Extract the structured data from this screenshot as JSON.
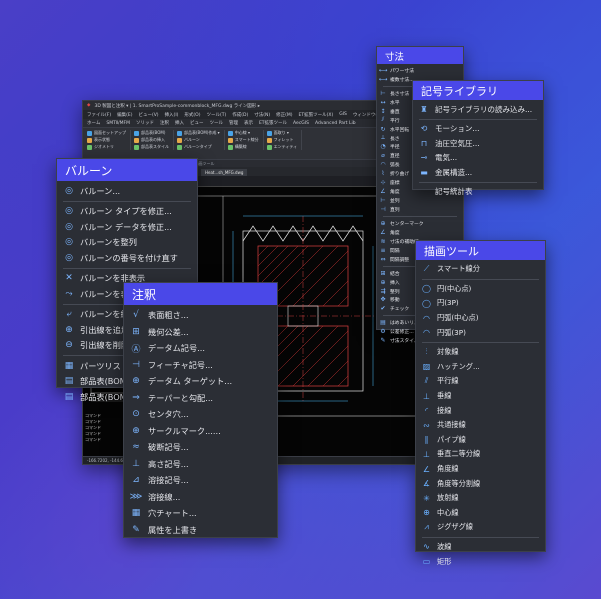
{
  "cad": {
    "title_bar": "3D 製図と注釈 ▾  |  1. SmartProSample-commonblock_MFG.dwg ライン図形 ▸",
    "menu": [
      "ファイル(F)",
      "編集(E)",
      "ビュー(V)",
      "挿入(I)",
      "形式(O)",
      "ツール(T)",
      "作成(D)",
      "寸法(N)",
      "修正(M)",
      "ET拡張ツール(X)",
      "GIS",
      "ウィンドウ(W)",
      "ヘルプ(H)",
      "ArcGIS"
    ],
    "ribbon_tabs": [
      "ホーム",
      "SMTⅡ/MFM",
      "ソリッド",
      "注釈",
      "挿入",
      "ビュー",
      "ツール",
      "管理",
      "表示",
      "ET拡張ツール",
      "AecGIS",
      "Advanced Part Lib"
    ],
    "ribbon_groups": [
      [
        "図面セットアップ",
        "表示状態",
        "ジオメトリ"
      ],
      [
        "部品表(BOM)",
        "部品表の挿入",
        "部品表スタイル"
      ],
      [
        "部品表(BOM)作成 ▾",
        "バルーン",
        "バルーンタイプ"
      ],
      [
        "中心線 ▾",
        "スマート線分",
        "構築線"
      ],
      [
        "面取り ▾",
        "フィレット",
        "エンティティ"
      ]
    ],
    "group_labels": [
      "バルーン 部品表(BOM)",
      "描画ツール"
    ],
    "doc_tab": "Heat...sh_MFG.dwg",
    "command_lines": [
      "コマンド",
      "コマンド",
      "コマンド",
      "コマンド",
      "コマンド"
    ],
    "status": "-166.7202, -144.6964, 0.0000"
  },
  "balloon": {
    "title": "バルーン",
    "items": [
      {
        "icon": "balloon-icon",
        "glyph": "◎",
        "label": "バルーン..."
      },
      {
        "sep": true
      },
      {
        "icon": "balloon-edit-icon",
        "glyph": "◎",
        "label": "バルーン タイプを修正..."
      },
      {
        "icon": "balloon-data-icon",
        "glyph": "◎",
        "label": "バルーン データを修正..."
      },
      {
        "icon": "balloon-align-icon",
        "glyph": "◎",
        "label": "バルーンを整列"
      },
      {
        "icon": "balloon-renumber-icon",
        "glyph": "◎",
        "label": "バルーンの番号を付け直す"
      },
      {
        "sep": true
      },
      {
        "icon": "balloon-hide-icon",
        "glyph": "✕",
        "label": "バルーンを非表示"
      },
      {
        "icon": "balloon-show-icon",
        "glyph": "⤳",
        "label": "バルーンを表示"
      },
      {
        "sep": true
      },
      {
        "icon": "balloon-merge-icon",
        "glyph": "⤶",
        "label": "バルーンを結合"
      },
      {
        "icon": "leader-add-icon",
        "glyph": "⊕",
        "label": "引出線を追加"
      },
      {
        "icon": "leader-delete-icon",
        "glyph": "⊖",
        "label": "引出線を削除"
      },
      {
        "sep": true
      },
      {
        "icon": "parts-list-icon",
        "glyph": "▦",
        "label": "パーツリストの生成"
      },
      {
        "icon": "bom-icon",
        "glyph": "▤",
        "label": "部品表(BOM)"
      },
      {
        "icon": "bom-icon-2",
        "glyph": "▤",
        "label": "部品表(BOM)"
      }
    ]
  },
  "annotation": {
    "title": "注釈",
    "items": [
      {
        "icon": "surface-roughness-icon",
        "glyph": "√",
        "label": "表面粗さ..."
      },
      {
        "icon": "geometric-tolerance-icon",
        "glyph": "⊞",
        "label": "幾何公差..."
      },
      {
        "icon": "datum-symbol-icon",
        "glyph": "Ⓐ",
        "label": "データム記号..."
      },
      {
        "icon": "feature-symbol-icon",
        "glyph": "⊣",
        "label": "フィーチャ記号..."
      },
      {
        "icon": "datum-target-icon",
        "glyph": "⊕",
        "label": "データム ターゲット..."
      },
      {
        "icon": "taper-slope-icon",
        "glyph": "⇒",
        "label": "テーパーと勾配..."
      },
      {
        "icon": "center-hole-icon",
        "glyph": "⊙",
        "label": "センタ穴..."
      },
      {
        "icon": "circle-mark-icon",
        "glyph": "⊕",
        "label": "サークルマーク......"
      },
      {
        "icon": "break-symbol-icon",
        "glyph": "≈",
        "label": "破断記号..."
      },
      {
        "icon": "height-symbol-icon",
        "glyph": "⊥",
        "label": "高さ記号..."
      },
      {
        "icon": "weld-symbol-icon",
        "glyph": "⊿",
        "label": "溶接記号..."
      },
      {
        "icon": "weld-line-icon",
        "glyph": "⋙",
        "label": "溶接線..."
      },
      {
        "icon": "hole-chart-icon",
        "glyph": "▦",
        "label": "穴チャート..."
      },
      {
        "icon": "attribute-override-icon",
        "glyph": "✎",
        "label": "属性を上書き"
      }
    ]
  },
  "dimension": {
    "title": "寸法",
    "items": [
      {
        "icon": "smart-dim-icon",
        "glyph": "⟷",
        "label": "パワー寸法"
      },
      {
        "icon": "multi-dim-icon",
        "glyph": "⟷",
        "label": "複数寸法..."
      },
      {
        "sep": true
      },
      {
        "icon": "ordinate-dim-icon",
        "glyph": "⊢",
        "label": "長さ寸法"
      },
      {
        "icon": "horizontal-dim-icon",
        "glyph": "↔",
        "label": "水平"
      },
      {
        "icon": "vertical-dim-icon",
        "glyph": "↕",
        "label": "垂直"
      },
      {
        "icon": "parallel-dim-icon",
        "glyph": "⫽",
        "label": "平行"
      },
      {
        "icon": "rotated-dim-icon",
        "glyph": "↻",
        "label": "水平回転"
      },
      {
        "icon": "sep-dim-icon",
        "glyph": "⟂",
        "label": "長さ"
      },
      {
        "icon": "radius-dim-icon",
        "glyph": "◔",
        "label": "半径"
      },
      {
        "icon": "diameter-dim-icon",
        "glyph": "⌀",
        "label": "直径"
      },
      {
        "icon": "arc-len-dim-icon",
        "glyph": "◠",
        "label": "弧長"
      },
      {
        "icon": "jog-dim-icon",
        "glyph": "⌇",
        "label": "折り曲げ"
      },
      {
        "icon": "coord-dim-icon",
        "glyph": "⊹",
        "label": "座標"
      },
      {
        "icon": "angle-dim-icon",
        "glyph": "∠",
        "label": "角度"
      },
      {
        "icon": "baseline-dim-icon",
        "glyph": "⊢",
        "label": "並列"
      },
      {
        "icon": "continue-dim-icon",
        "glyph": "⊣",
        "label": "直列"
      },
      {
        "sep": true
      },
      {
        "icon": "center-mark-icon",
        "glyph": "⊕",
        "label": "センターマーク"
      },
      {
        "icon": "angle-2-icon",
        "glyph": "∠",
        "label": "角度"
      },
      {
        "icon": "break-dim-icon",
        "glyph": "≋",
        "label": "寸法の補助線"
      },
      {
        "icon": "space-dim-icon",
        "glyph": "≡",
        "label": "間隔"
      },
      {
        "icon": "adjust-dim-icon",
        "glyph": "⇔",
        "label": "間隔調整"
      },
      {
        "sep": true
      },
      {
        "icon": "combine-dim-icon",
        "glyph": "⊞",
        "label": "結合"
      },
      {
        "icon": "insert-dim-icon",
        "glyph": "⊕",
        "label": "挿入"
      },
      {
        "icon": "align-dim-icon",
        "glyph": "⇶",
        "label": "整列"
      },
      {
        "icon": "move-dim-icon",
        "glyph": "✥",
        "label": "移動"
      },
      {
        "icon": "check-dim-icon",
        "glyph": "✔",
        "label": "チェック"
      },
      {
        "sep": true
      },
      {
        "icon": "fit-list-icon",
        "glyph": "▤",
        "label": "はめあいリスト"
      },
      {
        "icon": "style-dim-icon",
        "glyph": "⚙",
        "label": "公差修正..."
      },
      {
        "icon": "dim-style-icon",
        "glyph": "✎",
        "label": "寸法スタイル..."
      }
    ]
  },
  "symlib": {
    "title": "記号ライブラリ",
    "items": [
      {
        "icon": "symbol-library-icon",
        "glyph": "♜",
        "label": "記号ライブラリの読み込み..."
      },
      {
        "sep": true
      },
      {
        "icon": "motion-icon",
        "glyph": "⟲",
        "label": "モーション..."
      },
      {
        "icon": "hydraulic-icon",
        "glyph": "⊓",
        "label": "油圧空気圧..."
      },
      {
        "icon": "electric-icon",
        "glyph": "⊸",
        "label": "電気..."
      },
      {
        "icon": "metal-structure-icon",
        "glyph": "▬",
        "label": "金属構造..."
      },
      {
        "sep": true
      },
      {
        "icon": "",
        "glyph": "",
        "label": "記号統計表"
      }
    ]
  },
  "drawtools": {
    "title": "描画ツール",
    "items": [
      {
        "icon": "smart-line-icon",
        "glyph": "⟋",
        "label": "スマート線分"
      },
      {
        "sep": true
      },
      {
        "icon": "circle-center-icon",
        "glyph": "◯",
        "label": "円(中心点)"
      },
      {
        "icon": "circle-3p-icon",
        "glyph": "◯",
        "label": "円(3P)"
      },
      {
        "icon": "arc-center-icon",
        "glyph": "◠",
        "label": "円弧(中心点)"
      },
      {
        "icon": "arc-3p-icon",
        "glyph": "◠",
        "label": "円弧(3P)"
      },
      {
        "sep": true
      },
      {
        "icon": "symmetry-line-icon",
        "glyph": "⫶",
        "label": "対象線"
      },
      {
        "icon": "hatching-icon",
        "glyph": "▨",
        "label": "ハッチング..."
      },
      {
        "icon": "parallel-line-icon",
        "glyph": "⫽",
        "label": "平行線"
      },
      {
        "icon": "perpendicular-icon",
        "glyph": "⊥",
        "label": "垂線"
      },
      {
        "icon": "tangent-line-icon",
        "glyph": "◜",
        "label": "接線"
      },
      {
        "icon": "common-tangent-icon",
        "glyph": "∾",
        "label": "共通接線"
      },
      {
        "icon": "pipe-line-icon",
        "glyph": "∥",
        "label": "パイプ線"
      },
      {
        "icon": "bisector-icon",
        "glyph": "⊥",
        "label": "垂直二等分線"
      },
      {
        "icon": "angle-line-icon",
        "glyph": "∠",
        "label": "角度線"
      },
      {
        "icon": "angle-bisector-icon",
        "glyph": "∡",
        "label": "角度等分割線"
      },
      {
        "icon": "radial-line-icon",
        "glyph": "✳",
        "label": "放射線"
      },
      {
        "icon": "center-line-icon",
        "glyph": "⊕",
        "label": "中心線"
      },
      {
        "icon": "zigzag-line-icon",
        "glyph": "⩘",
        "label": "ジグザグ線"
      },
      {
        "sep": true
      },
      {
        "icon": "wave-line-icon",
        "glyph": "∿",
        "label": "波線"
      },
      {
        "icon": "rectangle-icon",
        "glyph": "▭",
        "label": "矩形"
      }
    ]
  }
}
